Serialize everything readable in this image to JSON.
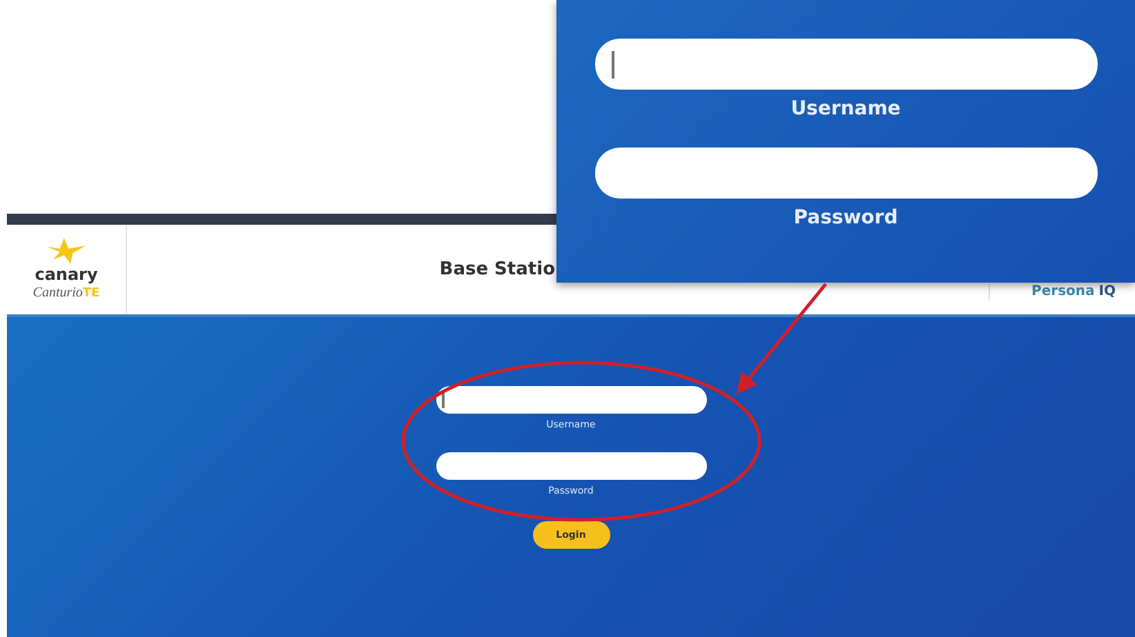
{
  "app": {
    "header": {
      "brand": "canary",
      "sub_brand": "Canturio",
      "sub_brand_suffix": "TE",
      "title": "Base Statio",
      "product": "Persona",
      "product_suffix": "IQ"
    },
    "login_form": {
      "fields": [
        {
          "label": "Username",
          "focused": true
        },
        {
          "label": "Password",
          "focused": false
        }
      ],
      "button": "Login"
    }
  },
  "callout": {
    "fields": [
      {
        "label": "Username",
        "focused": true
      },
      {
        "label": "Password",
        "focused": false
      }
    ]
  }
}
